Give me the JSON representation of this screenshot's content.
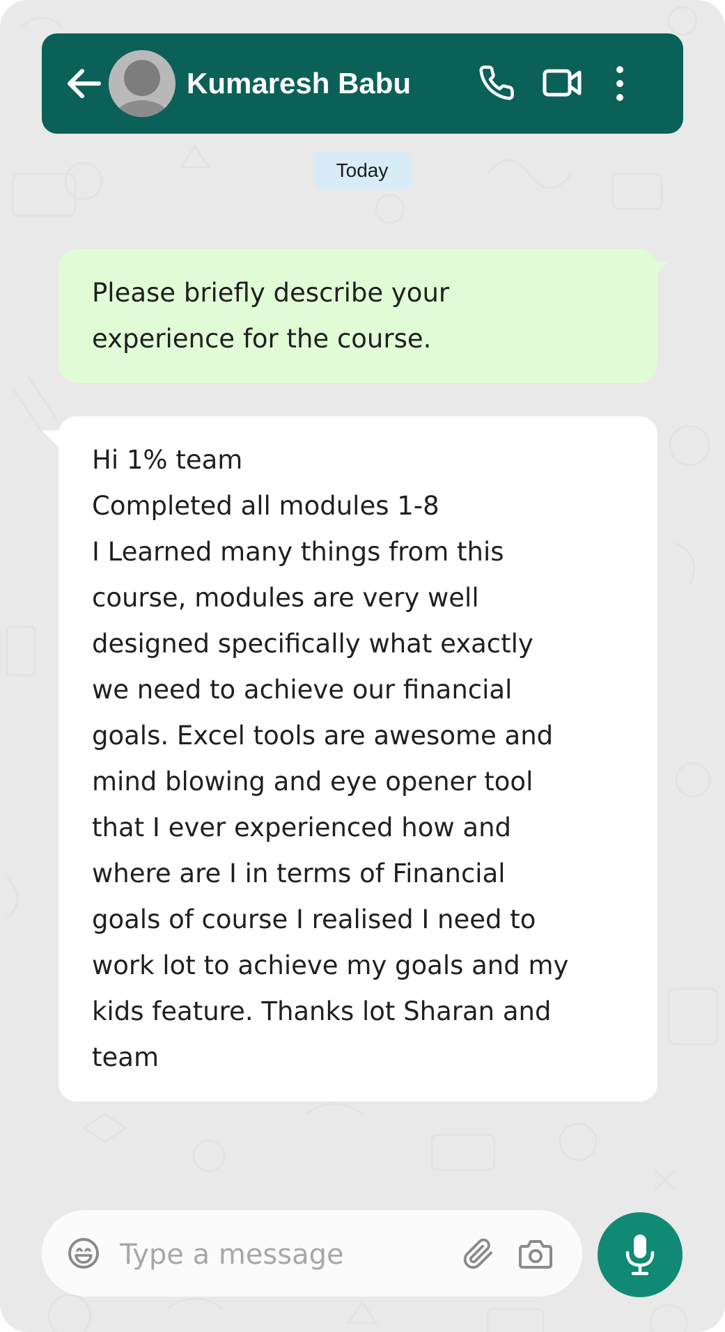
{
  "header": {
    "contact_name": "Kumaresh Babu",
    "back_icon": "arrow-left-icon",
    "call_icon": "phone-icon",
    "video_icon": "video-camera-icon",
    "menu_icon": "more-vertical-icon",
    "background_color": "#0b6158"
  },
  "chat": {
    "date_label": "Today",
    "messages": [
      {
        "direction": "outgoing",
        "text": "Please briefly describe your\nexperience for the course.",
        "bubble_color": "#e2fbd7"
      },
      {
        "direction": "incoming",
        "text": "Hi 1% team\nCompleted all modules 1-8\nI Learned many things from this\ncourse, modules are very well\ndesigned specifically what exactly\nwe need to achieve our financial\ngoals. Excel tools are awesome and\nmind blowing and eye opener tool\nthat I ever experienced how and\nwhere are I in terms of Financial\ngoals of course I realised I need to\nwork lot to achieve my goals and my\nkids feature. Thanks lot Sharan and\nteam",
        "bubble_color": "#ffffff"
      }
    ]
  },
  "composer": {
    "placeholder": "Type a message",
    "value": "",
    "emoji_icon": "emoji-icon",
    "attach_icon": "paperclip-icon",
    "camera_icon": "camera-icon",
    "mic_icon": "microphone-icon",
    "mic_button_color": "#108a74"
  }
}
